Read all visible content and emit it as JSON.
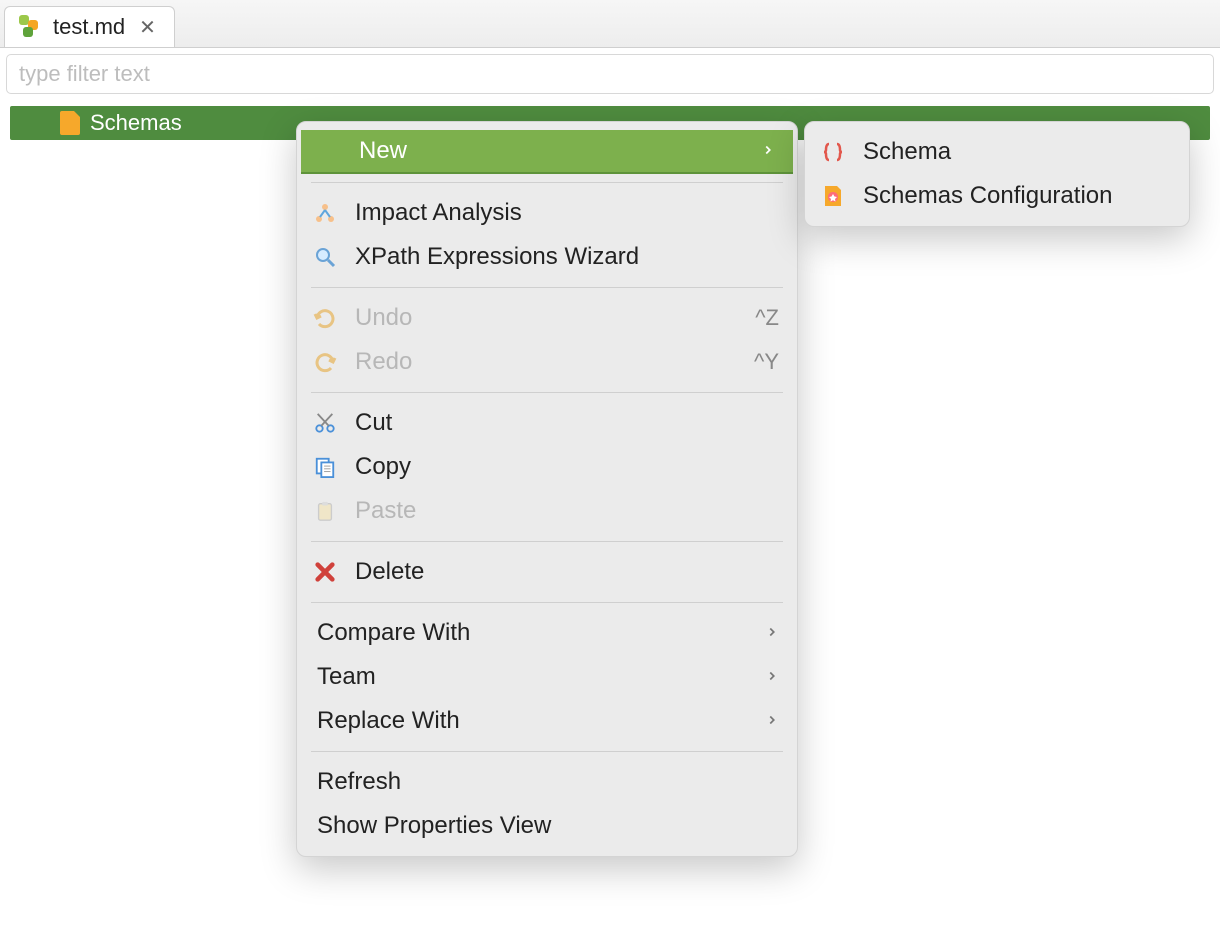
{
  "tab": {
    "label": "test.md"
  },
  "filter": {
    "placeholder": "type filter text"
  },
  "tree": {
    "selected_label": "Schemas"
  },
  "context_menu": {
    "new": "New",
    "impact_analysis": "Impact Analysis",
    "xpath_wizard": "XPath Expressions Wizard",
    "undo": "Undo",
    "undo_shortcut": "^Z",
    "redo": "Redo",
    "redo_shortcut": "^Y",
    "cut": "Cut",
    "copy": "Copy",
    "paste": "Paste",
    "delete": "Delete",
    "compare_with": "Compare With",
    "team": "Team",
    "replace_with": "Replace With",
    "refresh": "Refresh",
    "show_properties": "Show Properties View"
  },
  "submenu": {
    "schema": "Schema",
    "schemas_config": "Schemas Configuration"
  }
}
